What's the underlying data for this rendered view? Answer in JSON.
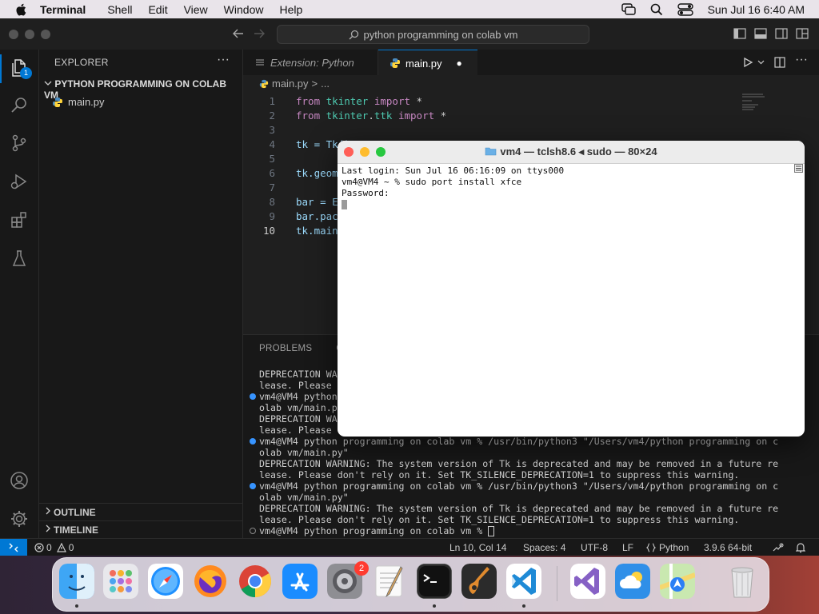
{
  "menubar": {
    "items": [
      "Terminal",
      "Shell",
      "Edit",
      "View",
      "Window",
      "Help"
    ],
    "clock": "Sun Jul 16  6:40 AM"
  },
  "titlebar": {
    "search_text": "python programming on colab vm"
  },
  "activity": {
    "explorer_badge": "1"
  },
  "sidebar": {
    "header": "EXPLORER",
    "more": "···",
    "folder": "PYTHON PROGRAMMING ON COLAB VM",
    "file": "main.py",
    "outline": "OUTLINE",
    "timeline": "TIMELINE"
  },
  "tabs": {
    "tab1": "Extension: Python",
    "tab2": "main.py",
    "dirty": "●"
  },
  "breadcrumb": {
    "file": "main.py",
    "sep": ">",
    "rest": "..."
  },
  "editor": {
    "line_numbers": [
      "1",
      "2",
      "3",
      "4",
      "5",
      "6",
      "7",
      "8",
      "9",
      "10"
    ],
    "l1": {
      "kw1": "from",
      "mod": "tkinter",
      "kw2": "import",
      "rest": " *"
    },
    "l2": {
      "kw1": "from",
      "mod": "tkinter",
      "dot": ".",
      "mod2": "ttk",
      "kw2": "import",
      "rest": " *"
    },
    "l4": "tk = Tk()",
    "l6": "tk.geom",
    "l8": "bar = E",
    "l9": "bar.pac",
    "l10": "tk.main"
  },
  "panel": {
    "tabs": [
      "PROBLEMS",
      "OU"
    ],
    "lines": [
      "DEPRECATION WA",
      "lease. Please",
      "vm4@VM4 python",
      "olab vm/main.p",
      "DEPRECATION WA",
      "lease. Please",
      "vm4@VM4 python programming on colab vm % /usr/bin/python3 \"/Users/vm4/python programming on c",
      "olab vm/main.py\"",
      "DEPRECATION WARNING: The system version of Tk is deprecated and may be removed in a future re",
      "lease. Please don't rely on it. Set TK_SILENCE_DEPRECATION=1 to suppress this warning.",
      "vm4@VM4 python programming on colab vm % /usr/bin/python3 \"/Users/vm4/python programming on c",
      "olab vm/main.py\"",
      "DEPRECATION WARNING: The system version of Tk is deprecated and may be removed in a future re",
      "lease. Please don't rely on it. Set TK_SILENCE_DEPRECATION=1 to suppress this warning.",
      "vm4@VM4 python programming on colab vm % "
    ]
  },
  "statusbar": {
    "errors": "0",
    "warnings": "0",
    "position": "Ln 10, Col 14",
    "spaces": "Spaces: 4",
    "encoding": "UTF-8",
    "eol": "LF",
    "language": "Python",
    "interpreter": "3.9.6 64-bit"
  },
  "terminal_window": {
    "title": "vm4 — tclsh8.6 ◂ sudo — 80×24",
    "lines": [
      "Last login: Sun Jul 16 06:16:09 on ttys000",
      "vm4@VM4 ~ % sudo port install xfce",
      "Password:"
    ]
  },
  "dock": {
    "settings_badge": "2"
  },
  "colors": {
    "accent": "#0078d4",
    "keyword": "#c586c0",
    "module": "#4ec9b0",
    "close": "#ff5f57",
    "minimize": "#febc2e",
    "zoom": "#28c840"
  }
}
